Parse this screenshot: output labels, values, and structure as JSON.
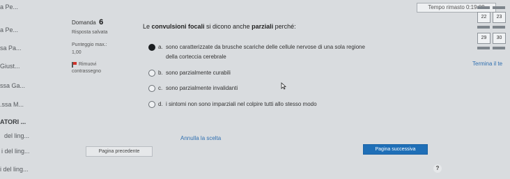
{
  "timer": {
    "text": "Tempo rimasto 0:19:09"
  },
  "sidebar": {
    "items": [
      {
        "label": "a Pe..."
      },
      {
        "label": "a Pe..."
      },
      {
        "label": "sa Pa..."
      },
      {
        "label": "Giust..."
      },
      {
        "label": "ssa Ga..."
      },
      {
        "label": ".ssa M..."
      },
      {
        "label": "ATORI ..."
      },
      {
        "label": "del ling..."
      },
      {
        "label": "i del ling..."
      },
      {
        "label": "i del ling..."
      }
    ]
  },
  "question_info": {
    "title": "Domanda",
    "number": "6",
    "status": "Risposta salvata",
    "score_label": "Punteggio max.:",
    "score_value": "1,00",
    "flag_label": "Rimuovi",
    "flag_label2": "contrassegno"
  },
  "question": {
    "text_prefix": "Le ",
    "text_bold1": "convulsioni focali",
    "text_mid": " si dicono anche ",
    "text_bold2": "parziali",
    "text_suffix": " perché:",
    "options": [
      {
        "letter": "a.",
        "line1": "sono caratterizzate da brusche scariche delle cellule nervose di una sola regione",
        "line2": "della corteccia cerebrale",
        "selected": true
      },
      {
        "letter": "b.",
        "line1": "sono parzialmente curabili",
        "selected": false
      },
      {
        "letter": "c.",
        "line1": "sono parzialmente invalidanti",
        "selected": false
      },
      {
        "letter": "d.",
        "line1": "i sintomi non sono imparziali nel colpire tutti allo stesso modo",
        "selected": false
      }
    ],
    "clear_choice": "Annulla la scelta"
  },
  "buttons": {
    "prev": "Pagina precedente",
    "next": "Pagina successiva",
    "help": "?"
  },
  "nav": {
    "row1": [
      "22",
      "23"
    ],
    "row2": [
      "29",
      "30"
    ],
    "finish": "Termina il te"
  },
  "colors": {
    "accent": "#1f6fb7",
    "link": "#2f6fb0",
    "flag": "#d0342c"
  }
}
